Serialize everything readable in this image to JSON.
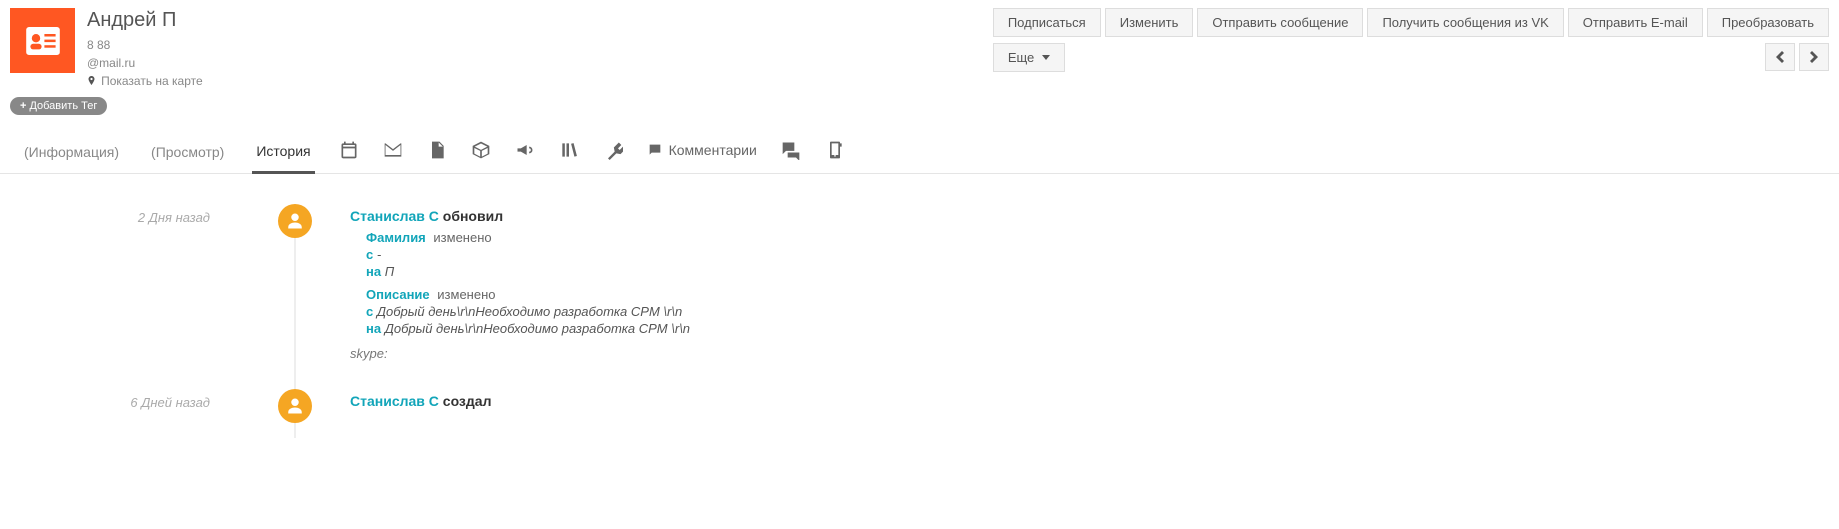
{
  "contact": {
    "name": "Андрей П",
    "phone": "8            88",
    "email": "        @mail.ru",
    "map_label": "Показать на карте"
  },
  "actions": {
    "subscribe": "Подписаться",
    "edit": "Изменить",
    "send_message": "Отправить сообщение",
    "get_vk": "Получить сообщения из VK",
    "send_email": "Отправить E-mail",
    "convert": "Преобразовать",
    "more": "Еще"
  },
  "tag_button": "Добавить Тег",
  "tabs": {
    "info": "(Информация)",
    "preview": "(Просмотр)",
    "history": "История",
    "comments": "Комментарии"
  },
  "timeline": [
    {
      "time": "2 Дня назад",
      "actor": "Станислав С",
      "action": "обновил",
      "changes": [
        {
          "field": "Фамилия",
          "tag": "изменено",
          "from": "-",
          "to": "П"
        },
        {
          "field": "Описание",
          "tag": "изменено",
          "from": "Добрый день\\r\\nНеобходимо разработка CPM \\r\\n",
          "to": "Добрый день\\r\\nНеобходимо разработка CPM \\r\\n"
        }
      ],
      "skype": "skype:"
    },
    {
      "time": "6 Дней назад",
      "actor": "Станислав С",
      "action": "создал"
    }
  ],
  "change_labels": {
    "from": "с",
    "to": "на"
  }
}
